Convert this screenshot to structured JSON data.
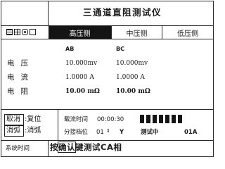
{
  "app_title": "三通道直阻测试仪",
  "tabs": [
    {
      "label": "高压侧",
      "active": true
    },
    {
      "label": "中压侧",
      "active": false
    },
    {
      "label": "低压侧",
      "active": false
    }
  ],
  "status_icons": [
    "menu-icon",
    "grid-icon",
    "record-icon",
    "box-icon"
  ],
  "channels": {
    "col1": "AB",
    "col2": "BC"
  },
  "rows": [
    {
      "label": "电压",
      "v1": "10.000mv",
      "v2": "10.000mv"
    },
    {
      "label": "电流",
      "v1": "1.0000 A",
      "v2": "1.0000 A"
    },
    {
      "label": "电阻",
      "v1": "10.00 mΩ",
      "v2": "10.00 mΩ"
    }
  ],
  "keys": {
    "cancel_key": "取消",
    "cancel_action": ":复位",
    "demag_key": "消弧",
    "demag_action": ":消弧"
  },
  "status": {
    "charge_time_label": "载流时间",
    "charge_time": "00:00:30",
    "charge_bars": 7,
    "tap_label": "分接档位",
    "tap_value": "01",
    "mode": "Y",
    "testing": "测试中",
    "phase": "01A"
  },
  "footer": {
    "system_time_label": "系统时间",
    "hint_pre": "按",
    "hint_key": "确认",
    "hint_post": "键测试CA相"
  },
  "colors": {
    "active_tab_bg": "#141414",
    "fg": "#1a1a1a",
    "bg": "#ffffff"
  }
}
